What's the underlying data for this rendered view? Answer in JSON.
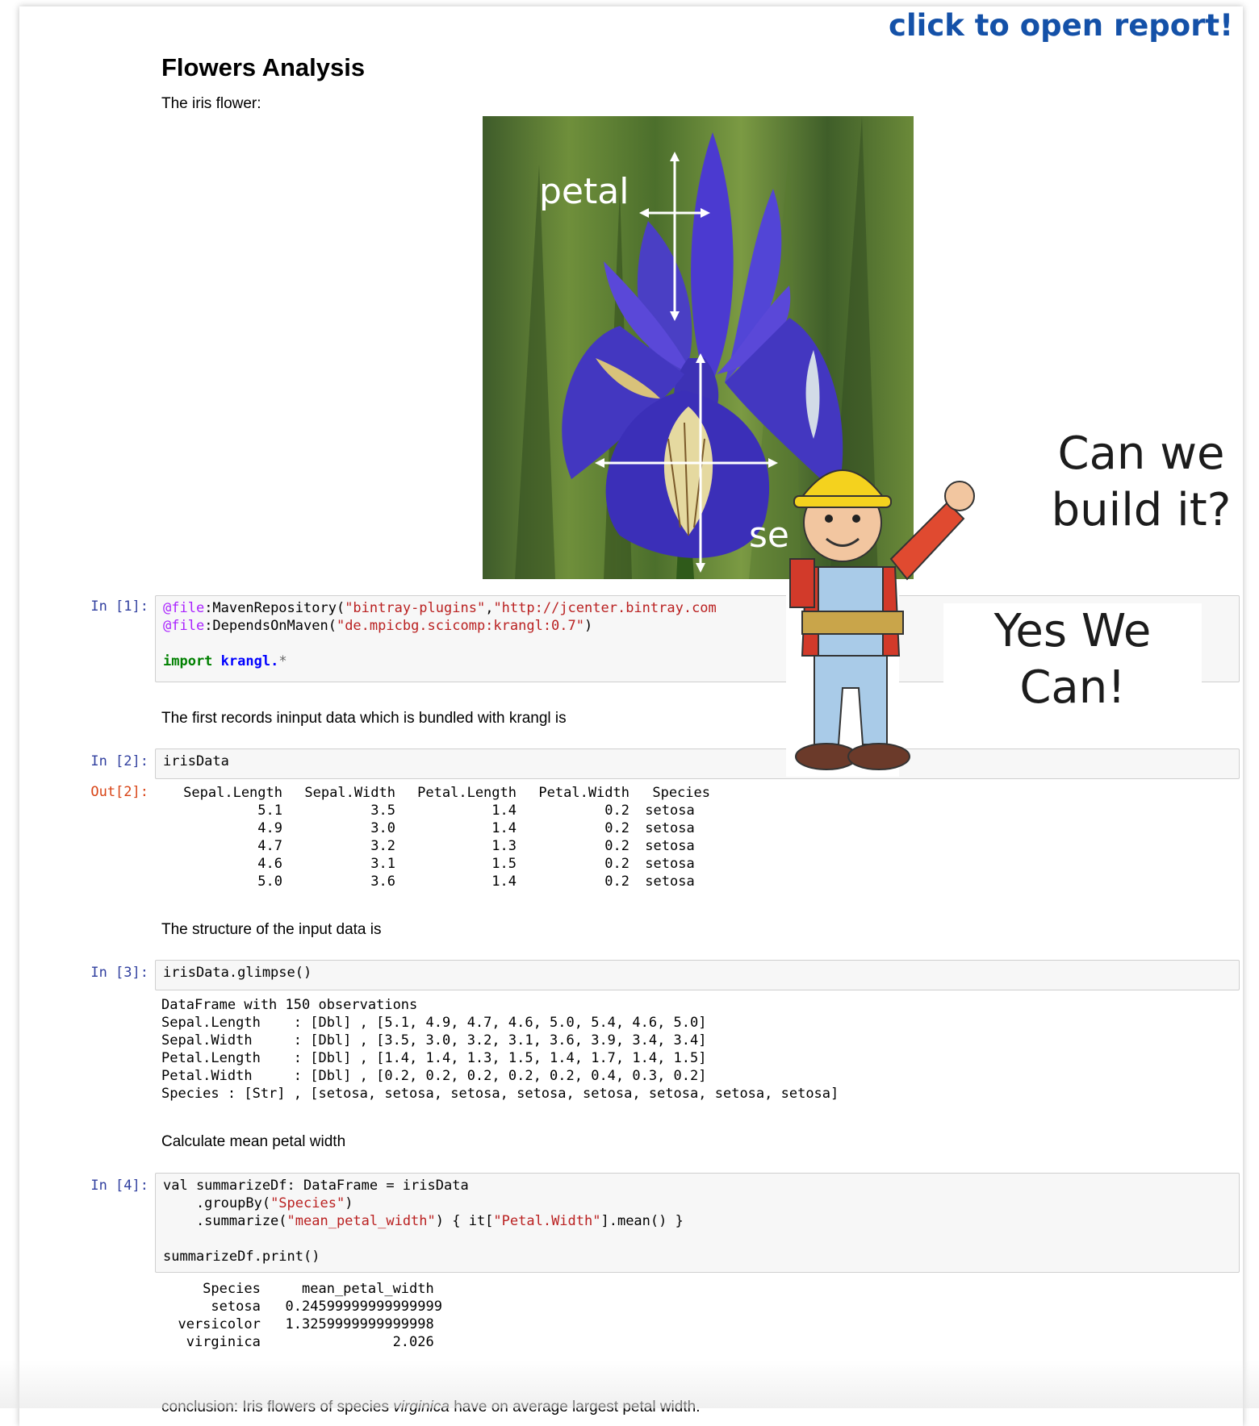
{
  "report_link": "click to open report!",
  "notebook": {
    "title": "Flowers Analysis",
    "intro": "The iris flower:",
    "figure": {
      "label_petal": "petal",
      "label_sepal": "se"
    },
    "meme": {
      "top": "Can we\nbuild it?",
      "bottom": "Yes We\nCan!"
    },
    "cell1": {
      "prompt": "In [1]:",
      "line1_dec": "@file",
      "line1_a": ":MavenRepository(",
      "line1_s1": "\"bintray-plugins\"",
      "line1_c": ",",
      "line1_s2": "\"http://jcenter.bintray.com",
      "line2_dec": "@file",
      "line2_a": ":DependsOnMaven(",
      "line2_s": "\"de.mpicbg.scicomp:krangl:0.7\"",
      "line2_b": ")",
      "import_kw": "import",
      "import_mod": "krangl.",
      "import_star": "*"
    },
    "md2": "The first records ininput data which is bundled with krangl is",
    "cell2": {
      "prompt_in": "In [2]:",
      "code": "irisData",
      "prompt_out": "Out[2]:",
      "headers": [
        "Sepal.Length",
        "Sepal.Width",
        "Petal.Length",
        "Petal.Width",
        "Species"
      ],
      "rows": [
        [
          "5.1",
          "3.5",
          "1.4",
          "0.2",
          "setosa"
        ],
        [
          "4.9",
          "3.0",
          "1.4",
          "0.2",
          "setosa"
        ],
        [
          "4.7",
          "3.2",
          "1.3",
          "0.2",
          "setosa"
        ],
        [
          "4.6",
          "3.1",
          "1.5",
          "0.2",
          "setosa"
        ],
        [
          "5.0",
          "3.6",
          "1.4",
          "0.2",
          "setosa"
        ]
      ]
    },
    "md3": "The structure of the input data is",
    "cell3": {
      "prompt": "In [3]:",
      "code": "irisData.glimpse()",
      "output": "DataFrame with 150 observations\nSepal.Length    : [Dbl] , [5.1, 4.9, 4.7, 4.6, 5.0, 5.4, 4.6, 5.0]\nSepal.Width     : [Dbl] , [3.5, 3.0, 3.2, 3.1, 3.6, 3.9, 3.4, 3.4]\nPetal.Length    : [Dbl] , [1.4, 1.4, 1.3, 1.5, 1.4, 1.7, 1.4, 1.5]\nPetal.Width     : [Dbl] , [0.2, 0.2, 0.2, 0.2, 0.2, 0.4, 0.3, 0.2]\nSpecies : [Str] , [setosa, setosa, setosa, setosa, setosa, setosa, setosa, setosa]"
    },
    "md4": "Calculate mean petal width",
    "cell4": {
      "prompt": "In [4]:",
      "l1": "val summarizeDf: DataFrame = irisData",
      "l2a": "    .groupBy(",
      "l2s": "\"Species\"",
      "l2b": ")",
      "l3a": "    .summarize(",
      "l3s": "\"mean_petal_width\"",
      "l3b": ") { it[",
      "l3s2": "\"Petal.Width\"",
      "l3c": "].mean() }",
      "l5": "summarizeDf.print()",
      "output": "     Species     mean_petal_width\n      setosa   0.24599999999999999\n  versicolor   1.3259999999999998\n   virginica                2.026"
    },
    "conclusion_a": "conclusion: Iris flowers of species ",
    "conclusion_em": "virginica",
    "conclusion_b": " have on average largest petal width."
  }
}
